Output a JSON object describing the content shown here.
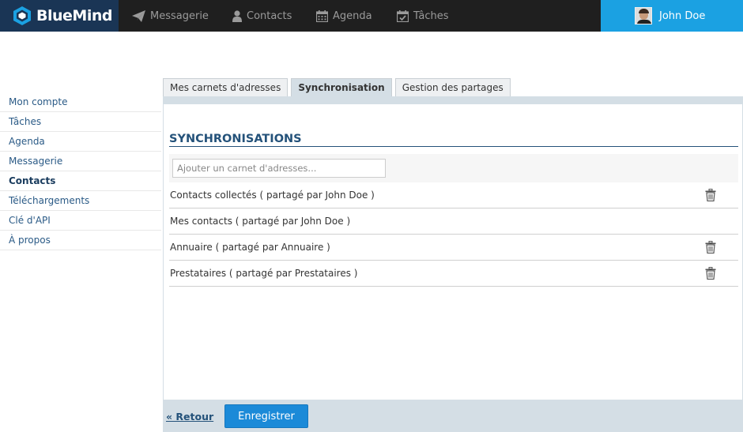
{
  "app": {
    "brand": "BlueMind",
    "accent": "#1ba1e2",
    "brand_bg": "#1a3555"
  },
  "nav": {
    "items": [
      {
        "label": "Messagerie",
        "icon": "paper-plane-icon"
      },
      {
        "label": "Contacts",
        "icon": "user-icon"
      },
      {
        "label": "Agenda",
        "icon": "calendar-icon"
      },
      {
        "label": "Tâches",
        "icon": "checked-calendar-icon"
      }
    ]
  },
  "user": {
    "name": "John Doe"
  },
  "sidebar": {
    "items": [
      {
        "label": "Mon compte"
      },
      {
        "label": "Tâches"
      },
      {
        "label": "Agenda"
      },
      {
        "label": "Messagerie"
      },
      {
        "label": "Contacts",
        "active": true
      },
      {
        "label": "Téléchargements"
      },
      {
        "label": "Clé d'API"
      },
      {
        "label": "À propos"
      }
    ]
  },
  "tabs": [
    {
      "label": "Mes carnets d'adresses"
    },
    {
      "label": "Synchronisation",
      "active": true
    },
    {
      "label": "Gestion des partages"
    }
  ],
  "section": {
    "title": "SYNCHRONISATIONS",
    "add_placeholder": "Ajouter un carnet d'adresses..."
  },
  "books": [
    {
      "label": "Contacts collectés ( partagé par John Doe )",
      "deletable": true
    },
    {
      "label": "Mes contacts ( partagé par John Doe )",
      "deletable": false
    },
    {
      "label": "Annuaire ( partagé par Annuaire )",
      "deletable": true
    },
    {
      "label": "Prestataires ( partagé par Prestataires )",
      "deletable": true
    }
  ],
  "footer": {
    "back_label": "« Retour",
    "save_label": "Enregistrer"
  }
}
